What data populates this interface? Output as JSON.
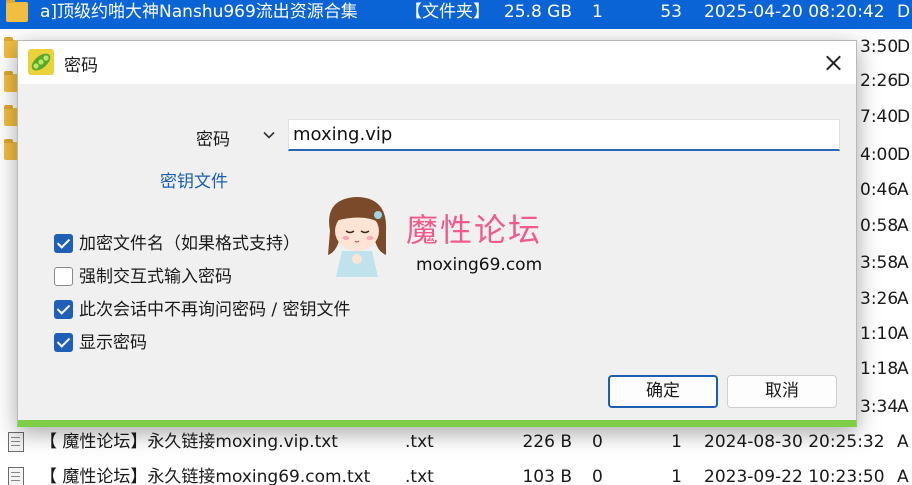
{
  "file_list": {
    "rows": [
      {
        "icon": "folder-icon",
        "name": "a]顶级约啪大神Nanshu969流出资源合集",
        "type": "【文件夹】",
        "size": "25.8 GB",
        "n1": "1",
        "n2": "53",
        "date": "2025-04-20 08:20:42",
        "attr": "D",
        "selected": true
      },
      {
        "icon": "file-icon",
        "name": "【 魔性论坛】永久链接moxing.vip.txt",
        "type": ".txt",
        "size": "226 B",
        "n1": "0",
        "n2": "1",
        "date": "2024-08-30 20:25:32",
        "attr": "A",
        "selected": false
      },
      {
        "icon": "file-icon",
        "name": "【 魔性论坛】永久链接moxing69.com.txt",
        "type": ".txt",
        "size": "103 B",
        "n1": "0",
        "n2": "1",
        "date": "2023-09-22 10:23:50",
        "attr": "A",
        "selected": false
      }
    ],
    "partial_rows": [
      {
        "time": "3:50",
        "attr": "D"
      },
      {
        "time": "2:26",
        "attr": "D"
      },
      {
        "time": "7:40",
        "attr": "D"
      },
      {
        "time": "4:00",
        "attr": "D"
      },
      {
        "time": "0:46",
        "attr": "A"
      },
      {
        "time": "0:58",
        "attr": "A"
      },
      {
        "time": "3:58",
        "attr": "A"
      },
      {
        "time": "3:26",
        "attr": "A"
      },
      {
        "time": "1:10",
        "attr": "A"
      },
      {
        "time": "1:18",
        "attr": "A"
      },
      {
        "time": "3:34",
        "attr": "A"
      }
    ]
  },
  "dialog": {
    "title": "密码",
    "password_label": "密码",
    "password_value": "moxing.vip",
    "key_file_link": "密钥文件",
    "options": [
      {
        "label": "加密文件名（如果格式支持）",
        "checked": true
      },
      {
        "label": "强制交互式输入密码",
        "checked": false
      },
      {
        "label": "此次会话中不再询问密码 / 密钥文件",
        "checked": true
      },
      {
        "label": "显示密码",
        "checked": true
      }
    ],
    "watermark": {
      "name": "魔性论坛",
      "url": "moxing69.com"
    },
    "ok_label": "确定",
    "cancel_label": "取消"
  },
  "colors": {
    "selection": "#0a64d6",
    "accent": "#1f5fb8",
    "dialog_bottom_bar": "#7ecf47",
    "watermark_pink": "#f05a8e"
  }
}
